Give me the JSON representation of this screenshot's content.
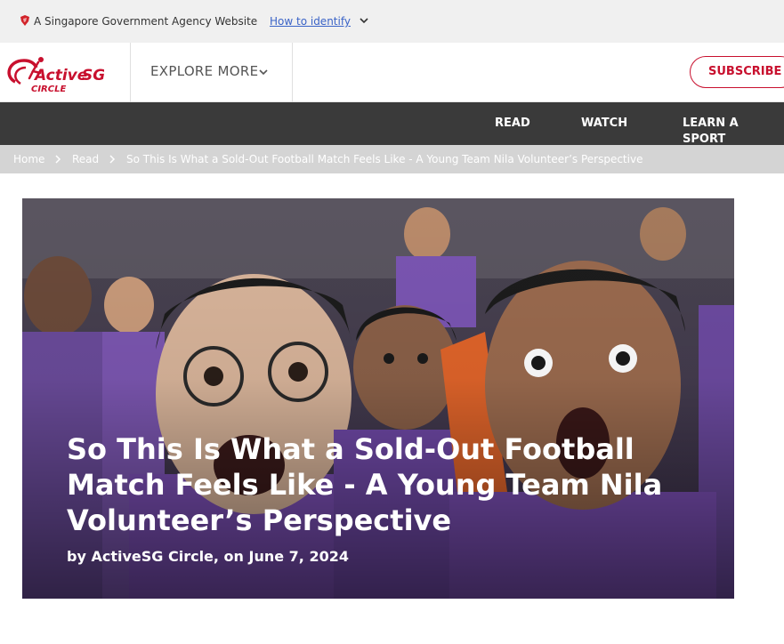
{
  "masthead": {
    "gov_text": "A Singapore Government Agency Website",
    "identify_link": "How to identify"
  },
  "topnav": {
    "logo_text": "ActiveSG",
    "logo_sub": "CIRCLE",
    "explore_label": "EXPLORE MORE",
    "subscribe_label": "SUBSCRIBE"
  },
  "categories": {
    "read": "READ",
    "watch": "WATCH",
    "learn": "LEARN A SPORT"
  },
  "breadcrumb": {
    "home": "Home",
    "read": "Read",
    "current": "So This Is What a Sold-Out Football Match Feels Like - A Young Team Nila Volunteer’s Perspective"
  },
  "article": {
    "title": "So This Is What a Sold-Out Football Match Feels Like - A Young Team Nila Volunteer’s Perspective",
    "byline": "by ActiveSG Circle, on June 7, 2024"
  },
  "colors": {
    "brand_red": "#c8102e",
    "catbar": "#3a3a3a",
    "breadcrumb_bg": "#d4d4d4",
    "jersey_purple": "#7b4fb5"
  }
}
